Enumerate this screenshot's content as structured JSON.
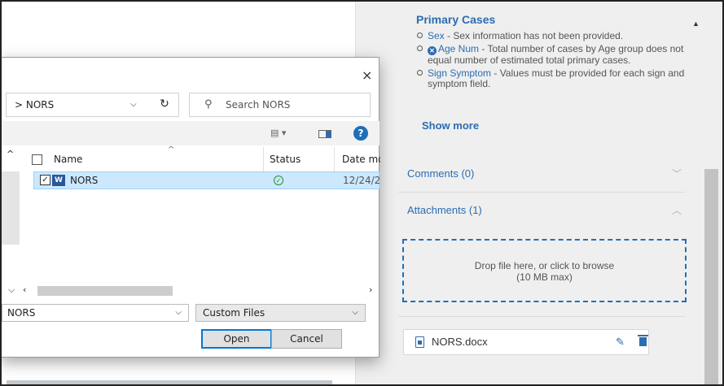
{
  "right_panel": {
    "primary_cases_title": "Primary Cases",
    "issues": [
      {
        "label": "Sex",
        "text": " - Sex information has not been provided."
      },
      {
        "label": "Age Num",
        "text": " - Total number of cases by Age group does not equal number of estimated total primary cases."
      },
      {
        "label": "Sign Symptom",
        "text": " - Values must be provided for each sign and symptom field."
      }
    ],
    "show_more": "Show more",
    "comments_label": "Comments (0)",
    "attachments_label": "Attachments (1)",
    "dropzone_line1": "Drop file here, or click to browse",
    "dropzone_line2": "(10 MB max)",
    "attachment_file": "NORS.docx"
  },
  "dialog": {
    "breadcrumb": "> NORS",
    "search_placeholder": "Search NORS",
    "columns": {
      "name": "Name",
      "status": "Status",
      "date": "Date mo"
    },
    "files": [
      {
        "name": "NORS",
        "date": "12/24/2"
      }
    ],
    "filename_value": "NORS",
    "filter_value": "Custom Files",
    "open_label": "Open",
    "cancel_label": "Cancel"
  },
  "icons": {
    "close": "×",
    "chevron_down": "⌄",
    "refresh": "↻",
    "search": "⌕",
    "help": "?"
  },
  "colors": {
    "link": "#2b6cb0",
    "selection": "#cce8ff",
    "focus": "#0078d7"
  }
}
